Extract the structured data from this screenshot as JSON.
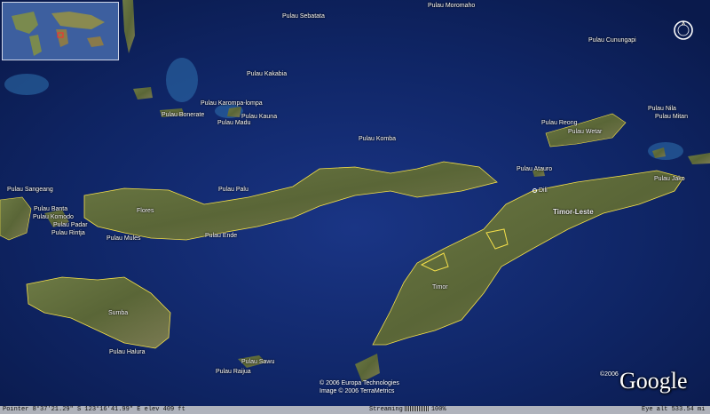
{
  "labels": [
    {
      "id": "pulau-sebatata",
      "text": "Pulau Sebatata"
    },
    {
      "id": "pulau-moromaho",
      "text": "Pulau Moromaho"
    },
    {
      "id": "pulau-cunungapi",
      "text": "Pulau Cunungapi"
    },
    {
      "id": "pulau-kakabia",
      "text": "Pulau Kakabia"
    },
    {
      "id": "pulau-karompa-lompa",
      "text": "Pulau Karompa-lompa"
    },
    {
      "id": "pulau-bonerate",
      "text": "Pulau Bonerate"
    },
    {
      "id": "pulau-kauna",
      "text": "Pulau Kauna"
    },
    {
      "id": "pulau-madu",
      "text": "Pulau Madu"
    },
    {
      "id": "pulau-komba",
      "text": "Pulau Komba"
    },
    {
      "id": "pulau-reong",
      "text": "Pulau Reong"
    },
    {
      "id": "pulau-wetar",
      "text": "Pulau Wetar"
    },
    {
      "id": "pulau-nila",
      "text": "Pulau Nila"
    },
    {
      "id": "pulau-mitan",
      "text": "Pulau Mitan"
    },
    {
      "id": "pulau-atauro",
      "text": "Pulau Atauro"
    },
    {
      "id": "pulau-jako",
      "text": "Pulau Jako"
    },
    {
      "id": "dili",
      "text": "Dili"
    },
    {
      "id": "timor-leste",
      "text": "Timor-Leste"
    },
    {
      "id": "pulau-sangeang",
      "text": "Pulau Sangeang"
    },
    {
      "id": "pulau-banta",
      "text": "Pulau Banta"
    },
    {
      "id": "pulau-komodo",
      "text": "Pulau Komodo"
    },
    {
      "id": "pulau-padar",
      "text": "Pulau Padar"
    },
    {
      "id": "pulau-rintja",
      "text": "Pulau Rintja"
    },
    {
      "id": "pulau-palu",
      "text": "Pulau Palu"
    },
    {
      "id": "flores",
      "text": "Flores"
    },
    {
      "id": "pulau-mules",
      "text": "Pulau Mules"
    },
    {
      "id": "pulau-ende",
      "text": "Pulau Ende"
    },
    {
      "id": "timor",
      "text": "Timor"
    },
    {
      "id": "sumba",
      "text": "Sumba"
    },
    {
      "id": "pulau-halura",
      "text": "Pulau Halura"
    },
    {
      "id": "pulau-sawu",
      "text": "Pulau Sawu"
    },
    {
      "id": "pulau-raijua",
      "text": "Pulau Raijua"
    }
  ],
  "credits": {
    "line1": "© 2006 Europa Technologies",
    "line2": "Image © 2006 TerraMetrics",
    "logo_copyright": "©2006",
    "logo": "Google"
  },
  "status": {
    "pointer": "Pointer  8°37'21.29\"  S   123°16'41.99\" E   elev   409 ft",
    "streaming_label": "Streaming",
    "streaming_percent": "100%",
    "eye_alt": "Eye alt   533.54 mi"
  },
  "colors": {
    "ocean": "#0e2a6e",
    "land": "#5f6b3c",
    "border": "#f5e04a"
  },
  "icons": {
    "compass": "compass-icon",
    "capital": "capital-dot-icon"
  }
}
